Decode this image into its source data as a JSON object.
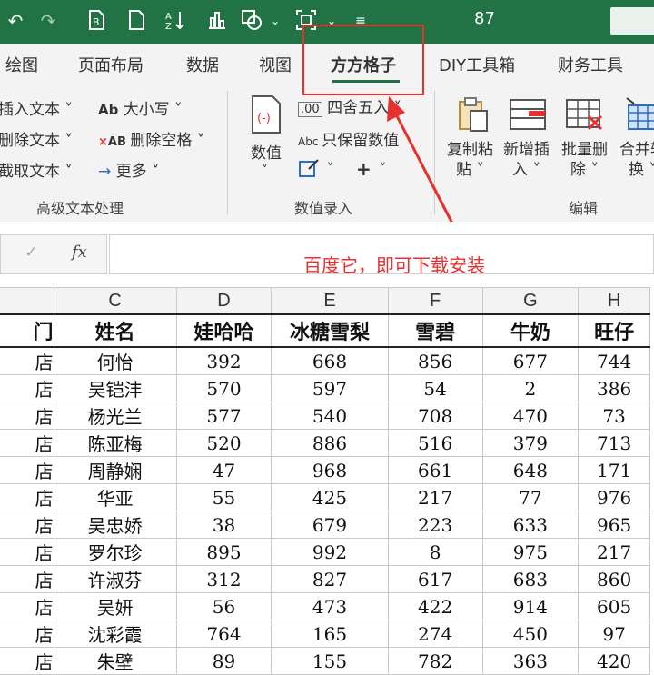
{
  "titlebar": {
    "zoom": "87",
    "quick_access": [
      "undo-icon",
      "redo-icon",
      "file-export-icon",
      "new-file-icon",
      "sort-icon",
      "chart-icon",
      "shapes-icon",
      "screenshot-icon",
      "more-icon"
    ]
  },
  "tabs": [
    {
      "label": "绘图"
    },
    {
      "label": "页面布局"
    },
    {
      "label": "数据"
    },
    {
      "label": "视图"
    },
    {
      "label": "方方格子",
      "active": true
    },
    {
      "label": "DIY工具箱"
    },
    {
      "label": "财务工具"
    }
  ],
  "ribbon": {
    "text_group": {
      "items": [
        "插入文本 ˅",
        "删除文本 ˅",
        "截取文本 ˅"
      ],
      "case": "大小写 ˅",
      "delete_spaces": "删除空格 ˅",
      "more": "更多 ˅",
      "label": "高级文本处理"
    },
    "number_group": {
      "value_btn": "数值",
      "round": "四舍五入 ˅",
      "keep_values": "只保留数值",
      "plus": "+",
      "label": "数值录入"
    },
    "edit_group": {
      "copy_paste": [
        "复制粘",
        "贴 ˅"
      ],
      "add_insert": [
        "新增插",
        "入 ˅"
      ],
      "batch_delete": [
        "批量删",
        "除 ˅"
      ],
      "merge": [
        "合并转",
        "换 ˅"
      ],
      "label": "编辑"
    }
  },
  "formula_bar": {
    "fx": "fx",
    "annotation": "百度它，即可下载安装"
  },
  "grid": {
    "columns": [
      "",
      "C",
      "D",
      "E",
      "F",
      "G",
      "H"
    ],
    "header": [
      "门",
      "姓名",
      "娃哈哈",
      "冰糖雪梨",
      "雪碧",
      "牛奶",
      "旺仔"
    ],
    "rows": [
      [
        "店",
        "何怡",
        "392",
        "668",
        "856",
        "677",
        "744"
      ],
      [
        "店",
        "吴铠沣",
        "570",
        "597",
        "54",
        "2",
        "386"
      ],
      [
        "店",
        "杨光兰",
        "577",
        "540",
        "708",
        "470",
        "73"
      ],
      [
        "店",
        "陈亚梅",
        "520",
        "886",
        "516",
        "379",
        "713"
      ],
      [
        "店",
        "周静娴",
        "47",
        "968",
        "661",
        "648",
        "171"
      ],
      [
        "店",
        "华亚",
        "55",
        "425",
        "217",
        "77",
        "976"
      ],
      [
        "店",
        "吴忠娇",
        "38",
        "679",
        "223",
        "633",
        "965"
      ],
      [
        "店",
        "罗尔珍",
        "895",
        "992",
        "8",
        "975",
        "217"
      ],
      [
        "店",
        "许淑芬",
        "312",
        "827",
        "617",
        "683",
        "860"
      ],
      [
        "店",
        "吴妍",
        "56",
        "473",
        "422",
        "914",
        "605"
      ],
      [
        "店",
        "沈彩霞",
        "764",
        "165",
        "274",
        "450",
        "97"
      ],
      [
        "店",
        "朱壁",
        "89",
        "155",
        "782",
        "363",
        "420"
      ]
    ]
  }
}
